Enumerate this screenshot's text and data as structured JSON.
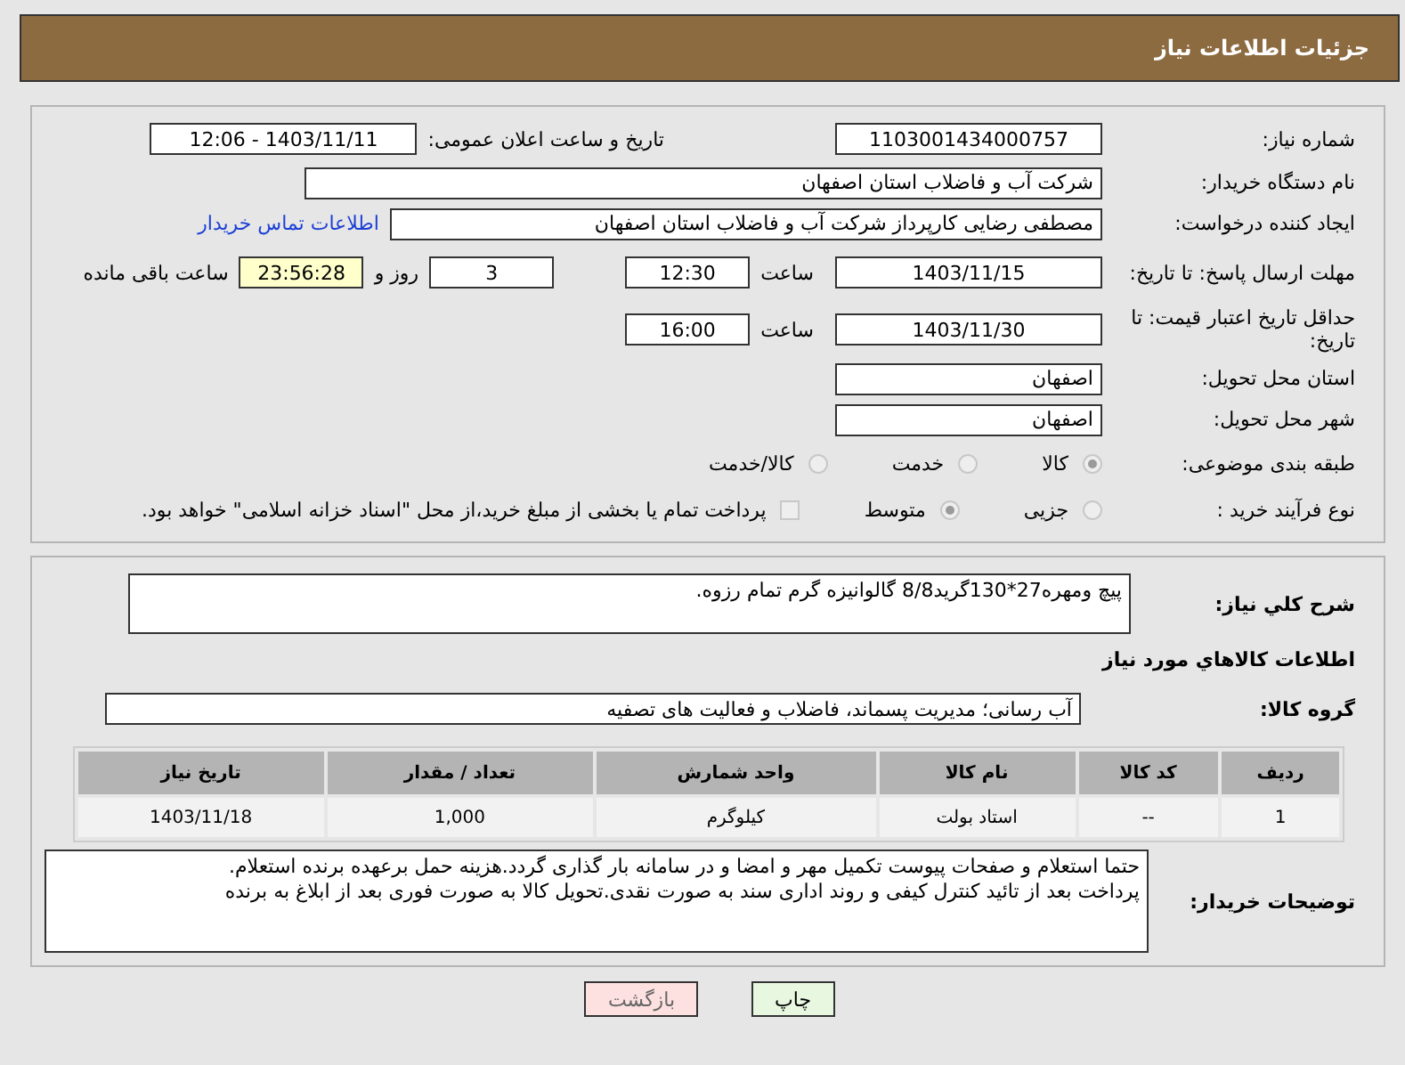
{
  "header": {
    "title": "جزئیات اطلاعات نیاز"
  },
  "need_number": {
    "label": "شماره نیاز:",
    "value": "1103001434000757"
  },
  "announce": {
    "label": "تاریخ و ساعت اعلان عمومی:",
    "value": "1403/11/11 - 12:06"
  },
  "buyer_org": {
    "label": "نام دستگاه خریدار:",
    "value": "شرکت آب و فاضلاب استان اصفهان"
  },
  "creator": {
    "label": "ایجاد کننده درخواست:",
    "value": "مصطفی رضایی کارپرداز شرکت آب و فاضلاب استان اصفهان",
    "link": "اطلاعات تماس خریدار"
  },
  "response_deadline": {
    "label": "مهلت ارسال پاسخ: تا تاریخ:",
    "date": "1403/11/15",
    "time_label": "ساعت",
    "time": "12:30",
    "days": "3",
    "days_label": "روز و",
    "remaining": "23:56:28",
    "remaining_label": "ساعت باقی مانده"
  },
  "price_validity": {
    "label": "حداقل تاریخ اعتبار قیمت: تا تاریخ:",
    "date": "1403/11/30",
    "time_label": "ساعت",
    "time": "16:00"
  },
  "province": {
    "label": "استان محل تحویل:",
    "value": "اصفهان"
  },
  "city": {
    "label": "شهر محل تحویل:",
    "value": "اصفهان"
  },
  "category": {
    "label": "طبقه بندی موضوعی:",
    "options": [
      {
        "label": "کالا",
        "selected": true
      },
      {
        "label": "خدمت",
        "selected": false
      },
      {
        "label": "کالا/خدمت",
        "selected": false
      }
    ]
  },
  "process": {
    "label": "نوع فرآیند خرید :",
    "options": [
      {
        "label": "جزیی",
        "selected": false
      },
      {
        "label": "متوسط",
        "selected": true
      }
    ],
    "treasury": {
      "checked": false,
      "label": "پرداخت تمام یا بخشی از مبلغ خرید،از محل \"اسناد خزانه اسلامی\" خواهد بود."
    }
  },
  "description": {
    "label": "شرح کلي نیاز:",
    "value": "پیچ ومهره27*130گرید8/8 گالوانیزه گرم تمام رزوه."
  },
  "goods_heading": "اطلاعات کالاهاي مورد نیاز",
  "goods_group": {
    "label": "گروه کالا:",
    "value": "آب رسانی؛ مدیریت پسماند، فاضلاب و فعالیت های تصفیه"
  },
  "table": {
    "columns": [
      "ردیف",
      "کد کالا",
      "نام کالا",
      "واحد شمارش",
      "تعداد / مقدار",
      "تاریخ نیاز"
    ],
    "rows": [
      [
        "1",
        "--",
        "استاد بولت",
        "کیلوگرم",
        "1,000",
        "1403/11/18"
      ]
    ]
  },
  "buyer_notes": {
    "label": "توضیحات خریدار:",
    "value": "حتما استعلام و صفحات پیوست تکمیل مهر و امضا و در سامانه بار گذاری گردد.هزینه حمل برعهده برنده استعلام.\nپرداخت بعد از تائید کنترل کیفی و روند اداری سند به صورت نقدی.تحویل کالا به صورت فوری بعد از ابلاغ به برنده"
  },
  "buttons": [
    {
      "label": "چاپ",
      "kind": "print"
    },
    {
      "label": "بازگشت",
      "kind": "back"
    }
  ]
}
